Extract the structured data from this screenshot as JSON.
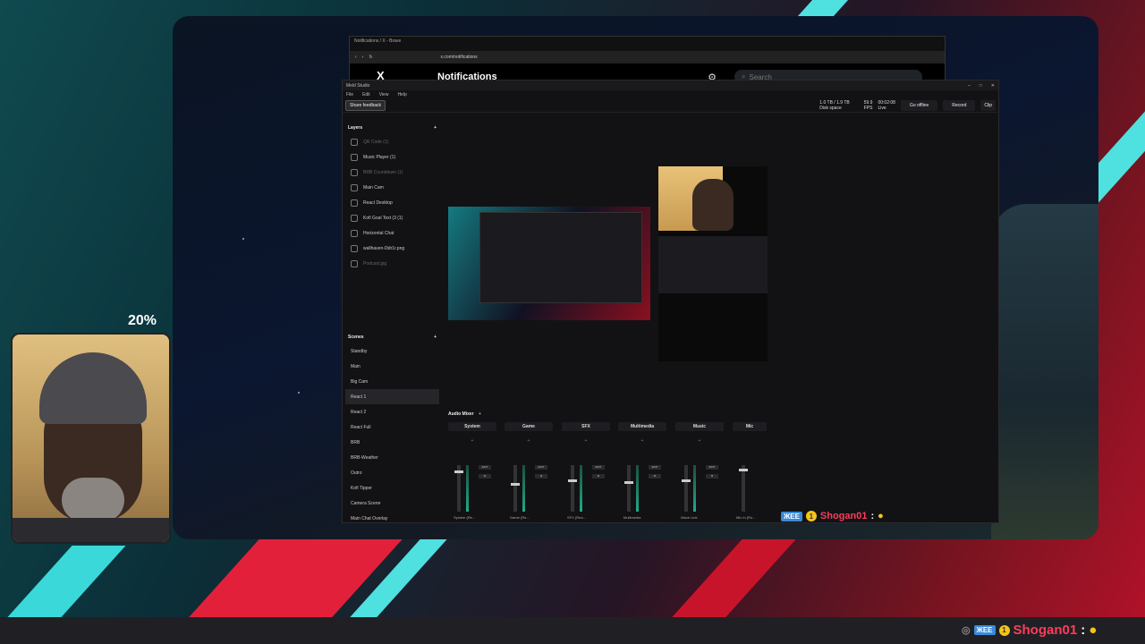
{
  "overlay": {
    "cam_percent": "20%"
  },
  "browser": {
    "window_title": "Notifications / X - Brave",
    "url": "x.com/notifications",
    "page_title": "Notifications",
    "search_placeholder": "Search",
    "logo": "X"
  },
  "studio": {
    "window_title": "Meld Studio",
    "menu": [
      "File",
      "Edit",
      "View",
      "Help"
    ],
    "share_feedback": "Share feedback",
    "disk_value": "1.0 TB / 1.9 TB",
    "disk_label": "Disk space",
    "fps_value": "59.9",
    "fps_label": "FPS",
    "live_time": "00:02:08",
    "live_label": "Live",
    "go_offline": "Go offline",
    "record": "Record",
    "clip": "Clip",
    "layers_header": "Layers",
    "layers": [
      {
        "label": "QR Code (1)",
        "dim": true
      },
      {
        "label": "Music Player (1)",
        "dim": false
      },
      {
        "label": "BRB Countdown (1)",
        "dim": true
      },
      {
        "label": "Main Cam",
        "dim": false
      },
      {
        "label": "React Desktop",
        "dim": false
      },
      {
        "label": "Kofi Goal Text (3 (1)",
        "dim": false
      },
      {
        "label": "Horizontal Chat",
        "dim": false
      },
      {
        "label": "wallhaven-l3dr1r.png",
        "dim": false
      },
      {
        "label": "Podcast.jpg",
        "dim": true
      }
    ],
    "scenes_header": "Scenes",
    "scenes": [
      "Standby",
      "Main",
      "Big Cam",
      "React 1",
      "React 2",
      "React Full",
      "BRB",
      "BRB-Weather",
      "Outro",
      "Kofi Tipper",
      "Camera Scene",
      "Main Chat Overlay"
    ],
    "active_scene": "React 1",
    "mixer_header": "Audio Mixer",
    "channels": [
      "System",
      "Game",
      "SFX",
      "Multimedia",
      "Music",
      "Mic"
    ],
    "channel_devices": [
      "System (Re...",
      "Game (Re...",
      "SFX (Rea...",
      "Multimedia",
      "Wave Link",
      "Mic In (Ro..."
    ]
  },
  "chat": {
    "username": "Shogan01",
    "separator": ":",
    "badge": "ЖЕЕ",
    "coin": "1"
  },
  "colors": {
    "accent_red": "#ff3b5a",
    "teal": "#36d0d0",
    "brand_red": "#d0142a"
  }
}
